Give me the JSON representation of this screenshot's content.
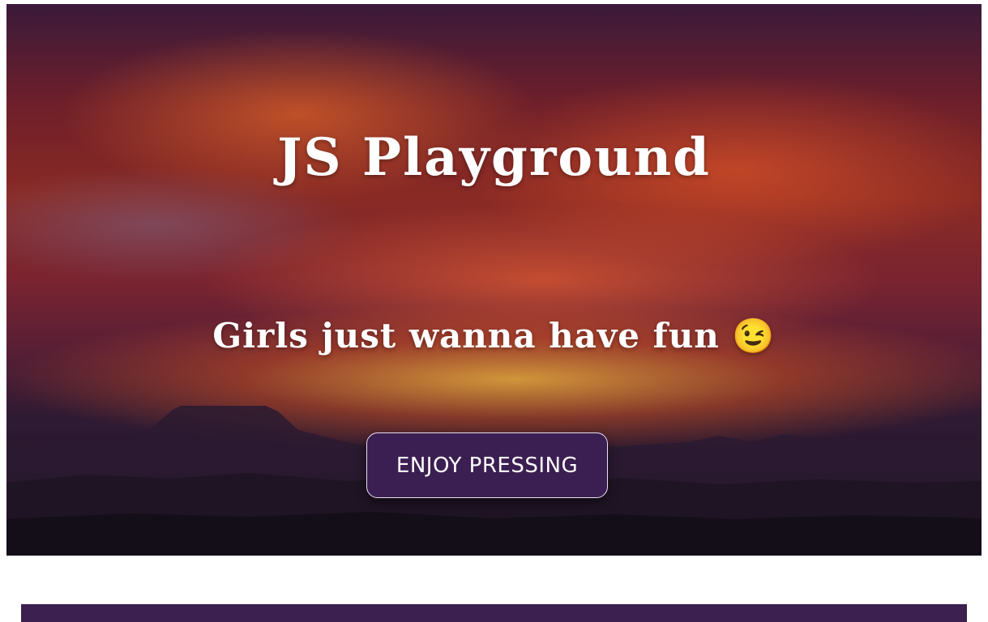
{
  "hero": {
    "title": "JS Playground",
    "subtitle": "Girls just wanna have fun 😉",
    "background": "sunset-sky-over-mountains"
  },
  "cta": {
    "label": "ENJOY PRESSING"
  },
  "colors": {
    "button_bg": "#3c1f52",
    "bottom_bar": "#3c2150",
    "text": "#ffffff"
  }
}
